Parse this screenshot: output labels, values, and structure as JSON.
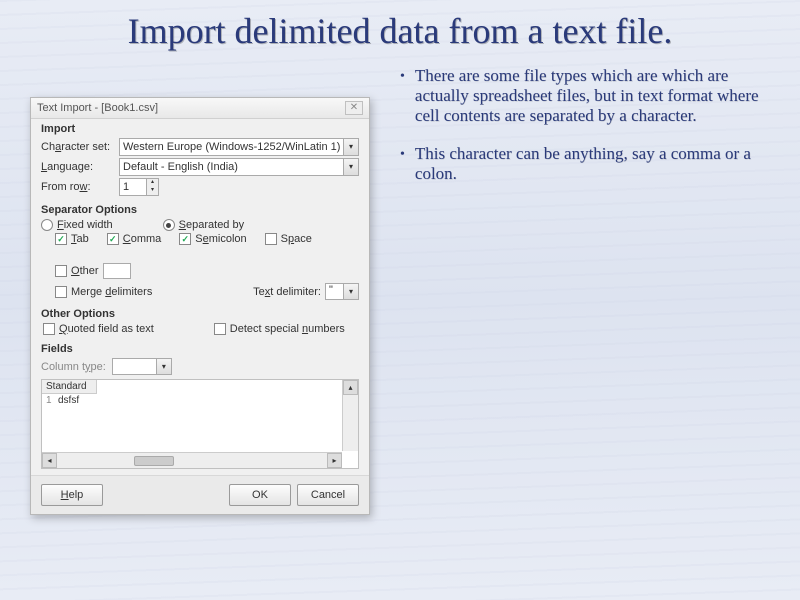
{
  "slide": {
    "title": "Import delimited data from a text file."
  },
  "bullets": [
    "There are some file types which are which are actually spreadsheet files, but in text format where cell contents are separated by a character.",
    "This character can be anything, say a comma or a colon."
  ],
  "dialog": {
    "title": "Text Import - [Book1.csv]",
    "import": {
      "section_label": "Import",
      "charset_label": "Character set:",
      "charset_value": "Western Europe (Windows-1252/WinLatin 1)",
      "language_label": "Language:",
      "language_value": "Default - English (India)",
      "fromrow_label": "From row:",
      "fromrow_value": "1"
    },
    "sep": {
      "section_label": "Separator Options",
      "fixed_label": "Fixed width",
      "separated_label": "Separated by",
      "tab": "Tab",
      "comma": "Comma",
      "semicolon": "Semicolon",
      "space": "Space",
      "other": "Other",
      "merge": "Merge delimiters",
      "textdelim_label": "Text delimiter:",
      "textdelim_value": "\""
    },
    "other": {
      "section_label": "Other Options",
      "quoted": "Quoted field as text",
      "detect": "Detect special numbers"
    },
    "fields": {
      "section_label": "Fields",
      "coltype_label": "Column type:",
      "header": "Standard",
      "sample": "dsfsf"
    },
    "buttons": {
      "help": "Help",
      "ok": "OK",
      "cancel": "Cancel"
    }
  }
}
